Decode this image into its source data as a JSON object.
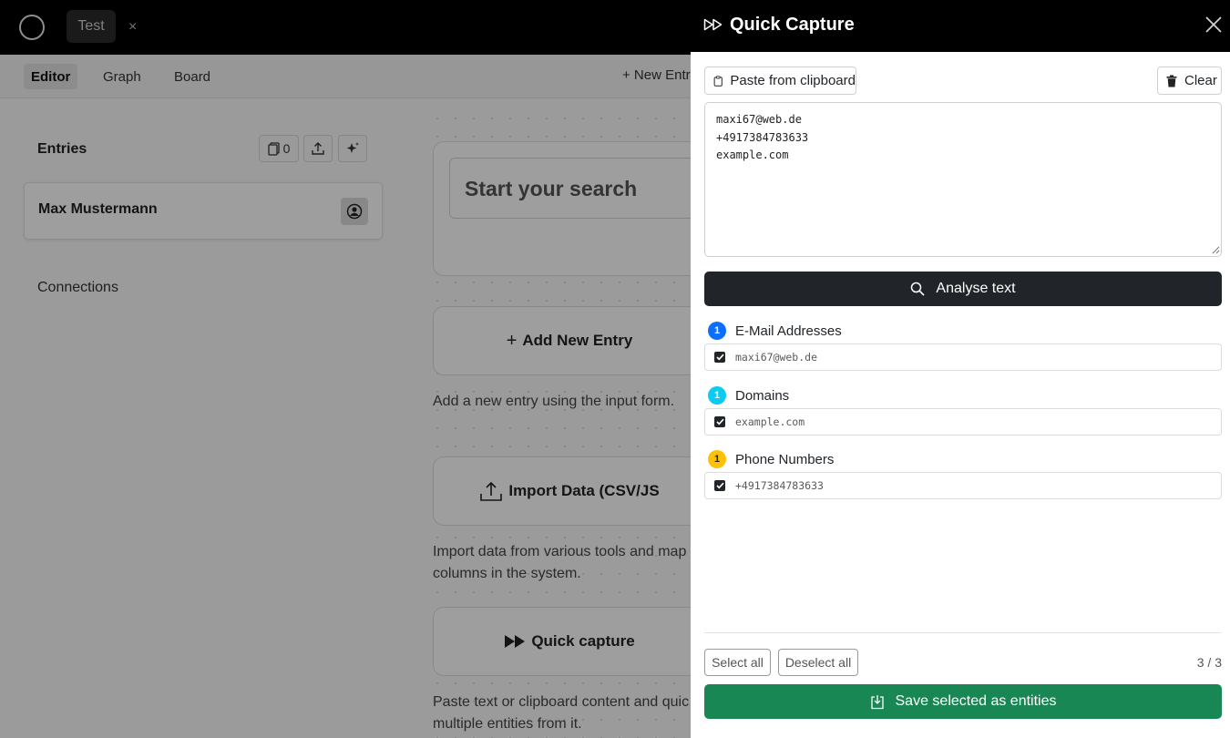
{
  "topbar": {
    "tab_label": "Test",
    "tab_close": "×"
  },
  "subnav": {
    "editor": "Editor",
    "graph": "Graph",
    "board": "Board",
    "new_entry": "+ New Entr"
  },
  "sidebar": {
    "entries_title": "Entries",
    "entries_count": "0",
    "entry_name": "Max Mustermann",
    "connections": "Connections"
  },
  "main": {
    "search_placeholder": "Start your search",
    "add_entry_label": "Add New Entry",
    "add_entry_desc": "Add a new entry using the input form.",
    "import_label": "Import Data (CSV/JS",
    "import_desc": "Import data from various tools and map columns in the system.",
    "quick_capture_label": "Quick capture",
    "quick_capture_desc": "Paste text or clipboard content and quic multiple entities from it."
  },
  "panel": {
    "title": "Quick Capture",
    "paste_button": "Paste from clipboard",
    "clear_button": "Clear",
    "textarea_value": "maxi67@web.de\n+4917384783633\nexample.com",
    "analyse_button": "Analyse text",
    "groups": [
      {
        "label": "E-Mail Addresses",
        "count": "1",
        "color": "#0d6efd",
        "value": "maxi67@web.de"
      },
      {
        "label": "Domains",
        "count": "1",
        "color": "#0dcaf0",
        "value": "example.com"
      },
      {
        "label": "Phone Numbers",
        "count": "1",
        "color": "#ffc107",
        "value": "+4917384783633"
      }
    ],
    "select_all": "Select all",
    "deselect_all": "Deselect all",
    "counter": "3 / 3",
    "save_button": "Save selected as entities"
  }
}
